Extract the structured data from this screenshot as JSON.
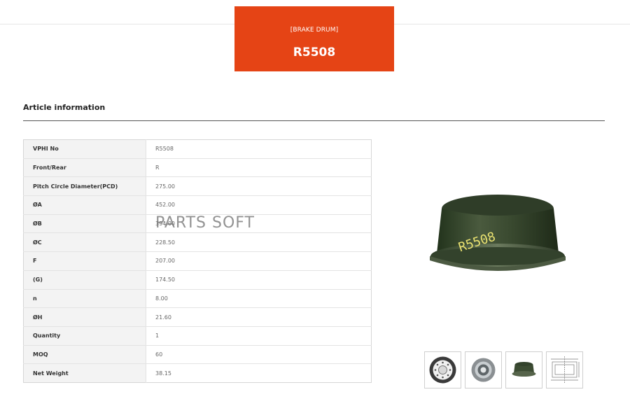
{
  "header": {
    "category": "[BRAKE DRUM]",
    "code": "R5508"
  },
  "section": {
    "title": "Article information"
  },
  "specs": [
    {
      "key": "VPHI No",
      "value": "R5508"
    },
    {
      "key": "Front/Rear",
      "value": "R"
    },
    {
      "key": "Pitch Circle Diameter(PCD)",
      "value": "275.00"
    },
    {
      "key": "ØA",
      "value": "452.00"
    },
    {
      "key": "ØB",
      "value": "394.00"
    },
    {
      "key": "ØC",
      "value": "228.50"
    },
    {
      "key": "F",
      "value": "207.00"
    },
    {
      "key": "(G)",
      "value": "174.50"
    },
    {
      "key": "n",
      "value": "8.00"
    },
    {
      "key": "ØH",
      "value": "21.60"
    },
    {
      "key": "Quantity",
      "value": "1"
    },
    {
      "key": "MOQ",
      "value": "60"
    },
    {
      "key": "Net Weight",
      "value": "38.15"
    }
  ],
  "watermark": "PARTS SOFT",
  "product_image": {
    "label": "R5508",
    "icon": "brake-drum-photo"
  },
  "thumbnails": [
    {
      "icon": "brake-drum-front-view"
    },
    {
      "icon": "brake-drum-inner-view"
    },
    {
      "icon": "brake-drum-side-view"
    },
    {
      "icon": "brake-drum-technical-drawing"
    }
  ],
  "colors": {
    "accent": "#e54415"
  }
}
